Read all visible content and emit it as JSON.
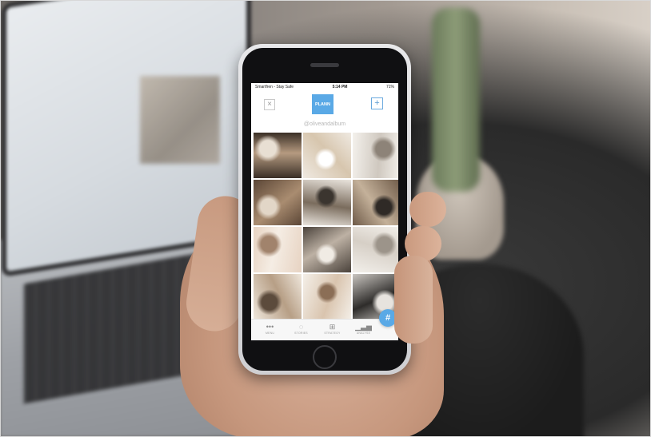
{
  "status_bar": {
    "carrier": "Smartfren - Stay Safe",
    "time": "5:14 PM",
    "battery": "71%"
  },
  "app": {
    "logo_text": "PLANN",
    "close_symbol": "×",
    "add_symbol": "+",
    "handle": "@oliveandalbum",
    "hashtag_symbol": "#",
    "accent_color": "#5aa9e6"
  },
  "tabs": [
    {
      "label": "MENU",
      "icon": "more-dots-icon"
    },
    {
      "label": "STORIES",
      "icon": "stories-circle-icon"
    },
    {
      "label": "STRATEGY",
      "icon": "grid-squares-icon"
    },
    {
      "label": "ANALYSE",
      "icon": "bar-chart-icon"
    }
  ],
  "grid_tiles": [
    {
      "name": "ceramics-studio-shelves",
      "colors": [
        "#3a2f26",
        "#b59a80",
        "#e8dfd3"
      ]
    },
    {
      "name": "white-vase-dried-flowers",
      "colors": [
        "#efe9e1",
        "#d7c6ae",
        "#ffffff"
      ]
    },
    {
      "name": "stacked-white-plates",
      "colors": [
        "#f4f1ec",
        "#cfc8bf",
        "#8d8378"
      ]
    },
    {
      "name": "wooden-shelf-pottery",
      "colors": [
        "#5b4636",
        "#a98c70",
        "#e2d6c7"
      ]
    },
    {
      "name": "potter-shelf-tools",
      "colors": [
        "#e9e4dd",
        "#7a6c5d",
        "#3b352f"
      ]
    },
    {
      "name": "workbench-ceramics",
      "colors": [
        "#6e5a48",
        "#c4b19a",
        "#2f2a26"
      ]
    },
    {
      "name": "hands-shaping-clay",
      "colors": [
        "#e7d3c2",
        "#f5ede4",
        "#a1836c"
      ]
    },
    {
      "name": "dark-bowls-tabletop",
      "colors": [
        "#4a423b",
        "#bdb1a4",
        "#f0ebe4"
      ]
    },
    {
      "name": "white-bowl-stack",
      "colors": [
        "#f2efea",
        "#d6cfc6",
        "#9c948a"
      ]
    },
    {
      "name": "shop-display-shelves",
      "colors": [
        "#efe7dc",
        "#b79f86",
        "#5c4b3c"
      ]
    },
    {
      "name": "hands-white-bowls",
      "colors": [
        "#f4efe8",
        "#d9c4ae",
        "#8b6e56"
      ]
    },
    {
      "name": "dark-vase-grey-wall",
      "colors": [
        "#c9c5c0",
        "#2e2c2a",
        "#e7e3de"
      ]
    }
  ]
}
